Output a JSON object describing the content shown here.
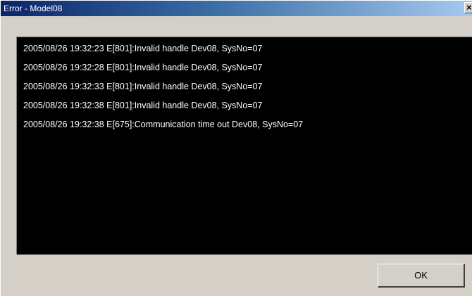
{
  "window": {
    "title": "Error - Model08",
    "close_glyph": "×",
    "close_icon": "close-icon"
  },
  "log": {
    "lines": [
      "2005/08/26 19:32:23 E[801]:Invalid handle Dev08, SysNo=07",
      "2005/08/26 19:32:28 E[801]:Invalid handle Dev08, SysNo=07",
      "2005/08/26 19:32:33 E[801]:Invalid handle Dev08, SysNo=07",
      "2005/08/26 19:32:38 E[801]:Invalid handle Dev08, SysNo=07",
      "2005/08/26 19:32:38 E[675]:Communication time out Dev08, SysNo=07"
    ]
  },
  "buttons": {
    "ok_label": "OK"
  },
  "colors": {
    "titlebar_start": "#0a246a",
    "titlebar_end": "#a6caf0",
    "log_background": "#000000",
    "log_text": "#ffffff",
    "window_background": "#d4d0c8"
  }
}
